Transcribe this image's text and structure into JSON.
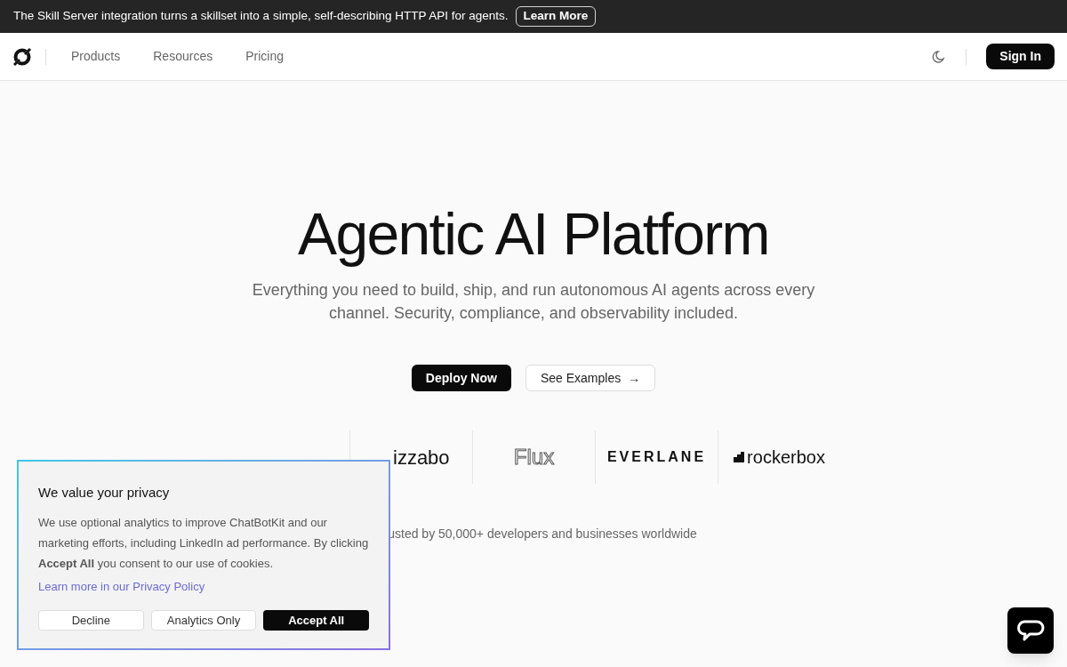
{
  "banner": {
    "text": "The Skill Server integration turns a skillset into a simple, self-describing HTTP API for agents.",
    "button": "Learn More"
  },
  "nav": {
    "items": [
      "Products",
      "Resources",
      "Pricing"
    ],
    "sign_in": "Sign In"
  },
  "hero": {
    "title": "Agentic AI Platform",
    "subtitle": "Everything you need to build, ship, and run autonomous AI agents across every channel. Security, compliance, and observability included.",
    "primary": "Deploy Now",
    "secondary": "See Examples",
    "secondary_icon": "→"
  },
  "logos": [
    {
      "kind": "bizzabo",
      "text": "izzabo"
    },
    {
      "kind": "flux",
      "text": "Flux"
    },
    {
      "kind": "everlane",
      "text": "EVERLANE"
    },
    {
      "kind": "rockerbox",
      "text": "rockerbox"
    }
  ],
  "trusted": "usted by 50,000+ developers and businesses worldwide",
  "cookie": {
    "title": "We value your privacy",
    "body": "We use optional analytics to improve ChatBotKit and our marketing efforts, including LinkedIn ad performance. By clicking **Accept All** you consent to our use of cookies.",
    "link": "Learn more in our Privacy Policy",
    "buttons": [
      {
        "label": "Decline",
        "kind": "outline"
      },
      {
        "label": "Analytics Only",
        "kind": "outline"
      },
      {
        "label": "Accept All",
        "kind": "solid"
      }
    ]
  }
}
